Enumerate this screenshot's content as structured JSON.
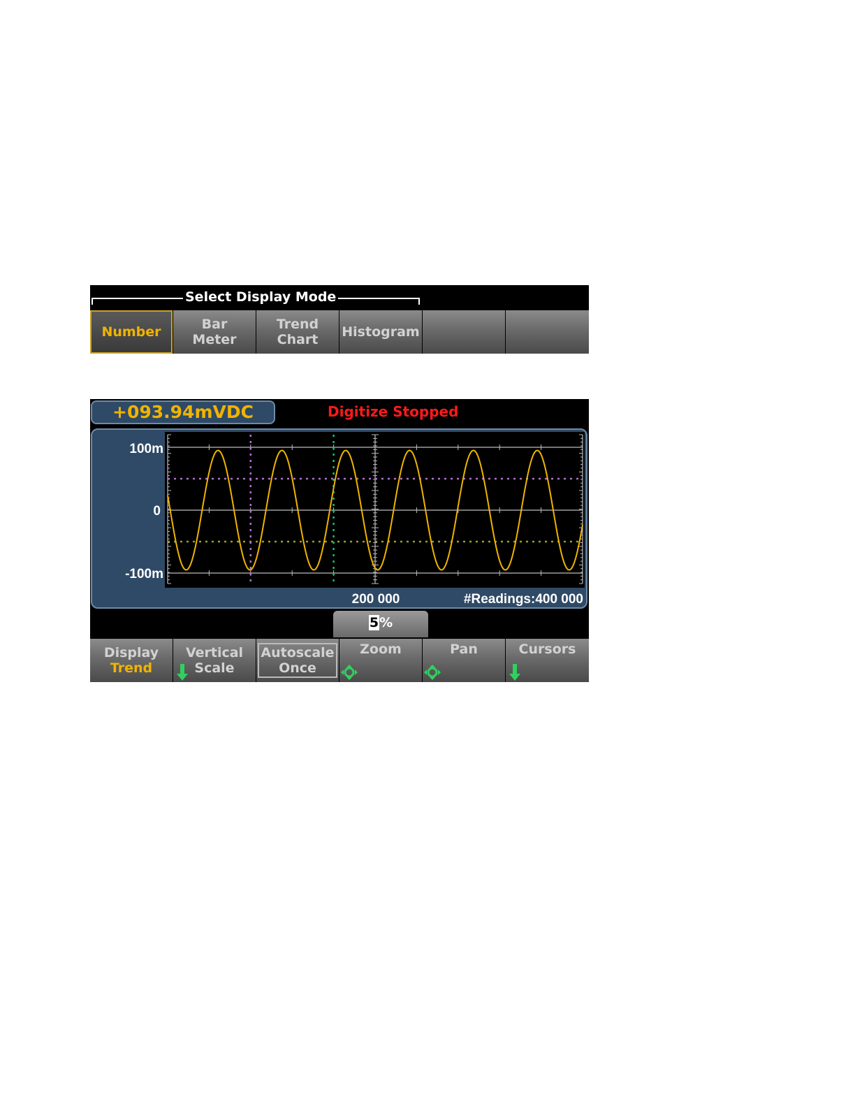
{
  "mode_menu": {
    "title": "Select Display Mode",
    "keys": [
      {
        "line1": "Number",
        "line2": "",
        "selected": true
      },
      {
        "line1": "Bar",
        "line2": "Meter",
        "selected": false
      },
      {
        "line1": "Trend",
        "line2": "Chart",
        "selected": false
      },
      {
        "line1": "Histogram",
        "line2": "",
        "selected": false
      },
      {
        "line1": "",
        "line2": "",
        "selected": false
      },
      {
        "line1": "",
        "line2": "",
        "selected": false
      }
    ]
  },
  "trend": {
    "reading": "+093.94mVDC",
    "status": "Digitize Stopped",
    "y_labels": [
      "100m",
      "0",
      "-100m"
    ],
    "x_center_label": "200 000",
    "readings_label": "#Readings:400 000",
    "zoom_value_cursor": "5",
    "zoom_value_rest": "%"
  },
  "softkeys": {
    "display": {
      "line1": "Display",
      "line2": "Trend"
    },
    "vertical_scale": {
      "line1": "Vertical",
      "line2": "Scale"
    },
    "autoscale": {
      "line1": "Autoscale",
      "line2": "Once"
    },
    "zoom": {
      "line1": "Zoom"
    },
    "pan": {
      "line1": "Pan"
    },
    "cursors": {
      "line1": "Cursors"
    }
  },
  "colors": {
    "trace": "#f0b400",
    "cursor_v1": "#b070d0",
    "cursor_v2": "#10c070",
    "cursor_h1": "#b070d0",
    "cursor_h2": "#9aa020",
    "status": "#ff1a1a",
    "accent": "#f0b400",
    "arrow": "#30d060"
  },
  "chart_data": {
    "type": "line",
    "series": [
      {
        "cycles": 6.5,
        "amplitude": 0.095,
        "phase_deg": 0
      }
    ],
    "ylim": [
      -0.1,
      0.1
    ],
    "x_range": [
      0,
      400000
    ],
    "y_ticks": [
      "100m",
      "0",
      "-100m"
    ],
    "x_tick_label": "200 000",
    "grid": true,
    "cursors": {
      "vertical": [
        80000,
        160000
      ],
      "horizontal": [
        0.05,
        -0.05
      ]
    }
  }
}
